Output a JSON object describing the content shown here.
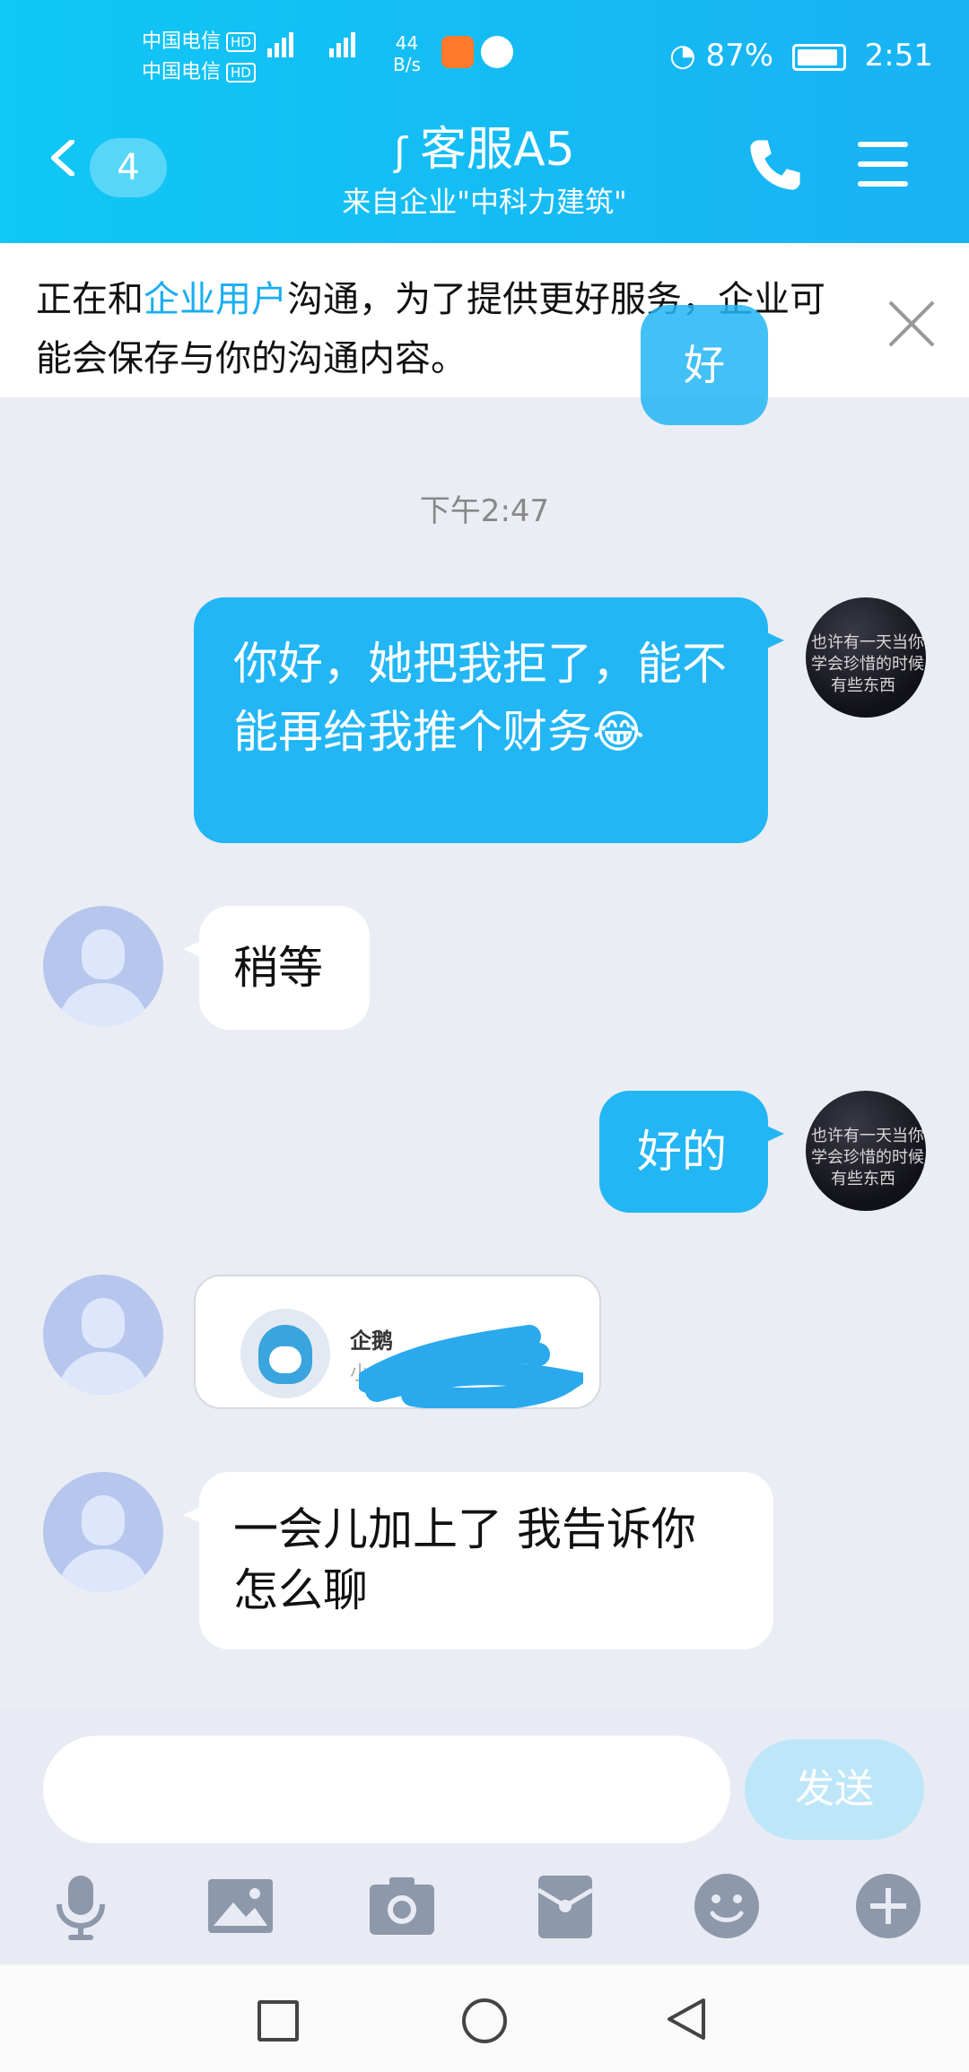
{
  "status": {
    "carrier1": "中国电信",
    "carrier2": "中国电信",
    "hd": "HD",
    "net_speed_value": "44",
    "net_speed_unit": "B/s",
    "battery": "87%",
    "time": "2:51"
  },
  "header": {
    "unread_count": "4",
    "title": "客服A5",
    "subtitle": "来自企业\"中科力建筑\""
  },
  "notice": {
    "text_before": "正在和",
    "link": "企业用户",
    "text_after": "沟通，为了提供更好服务，企业可能会保存与你的沟通内容。",
    "peek_bubble": "好"
  },
  "chat": {
    "timestamp": "下午2:47",
    "messages": [
      {
        "from": "me",
        "text": "你好，她把我拒了，能不能再给我推个财务😂"
      },
      {
        "from": "cs",
        "text": "稍等"
      },
      {
        "from": "me",
        "text": "好的"
      },
      {
        "from": "cs",
        "card_title": "企鹅",
        "card_sub": "小"
      },
      {
        "from": "cs",
        "text": "一会儿加上了 我告诉你怎么聊"
      }
    ],
    "avatar_text": [
      "也许有一天当你",
      "学会珍惜的时候",
      "有些东西"
    ]
  },
  "input": {
    "placeholder": "",
    "send_label": "发送"
  },
  "colors": {
    "header": "#19b2f4",
    "bubble_me": "#23b6f5",
    "background": "#eaedf4"
  }
}
